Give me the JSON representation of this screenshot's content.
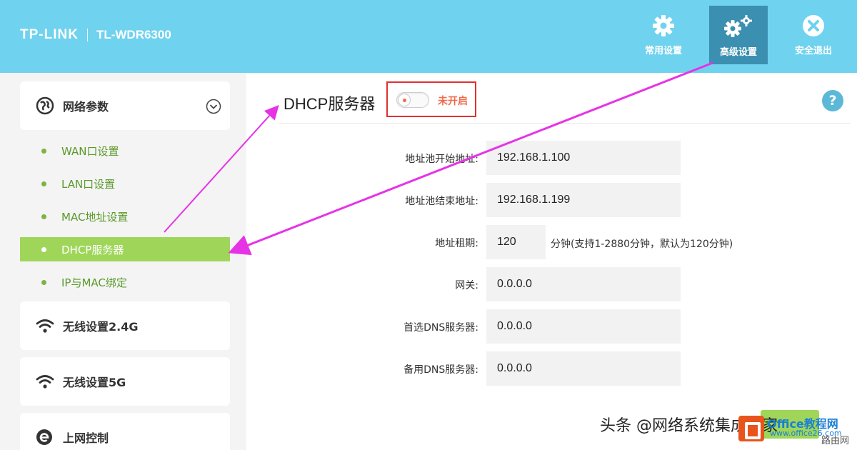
{
  "header": {
    "logo": "TP-LINK",
    "model": "TL-WDR6300",
    "nav": [
      {
        "label": "常用设置",
        "icon": "gear-icon"
      },
      {
        "label": "高级设置",
        "icon": "gears-icon"
      },
      {
        "label": "安全退出",
        "icon": "close-circle-icon"
      }
    ]
  },
  "sidebar": {
    "network_group": "网络参数",
    "sub_items": [
      "WAN口设置",
      "LAN口设置",
      "MAC地址设置",
      "DHCP服务器",
      "IP与MAC绑定"
    ],
    "active_item": "DHCP服务器",
    "wireless24": "无线设置2.4G",
    "wireless5": "无线设置5G",
    "access_control": "上网控制"
  },
  "main": {
    "title": "DHCP服务器",
    "toggle_status": "未开启",
    "help": "?",
    "fields": {
      "pool_start_label": "地址池开始地址:",
      "pool_start": "192.168.1.100",
      "pool_end_label": "地址池结束地址:",
      "pool_end": "192.168.1.199",
      "lease_label": "地址租期:",
      "lease": "120",
      "lease_hint": "分钟(支持1-2880分钟，默认为120分钟)",
      "gateway_label": "网关:",
      "gateway": "0.0.0.0",
      "dns1_label": "首选DNS服务器:",
      "dns1": "0.0.0.0",
      "dns2_label": "备用DNS服务器:",
      "dns2": "0.0.0.0"
    }
  },
  "watermark": {
    "text": "头条 @网络系统集成之家",
    "office_logo_text": "Office教程网",
    "office_site": "www.office26.com",
    "corner": "路由网"
  },
  "colors": {
    "header": "#6fd2ee",
    "active_nav": "#3b8fb0",
    "active_side": "#9fd65a",
    "annotation_arrow": "#e633e6",
    "highlight_box": "#e03030"
  }
}
